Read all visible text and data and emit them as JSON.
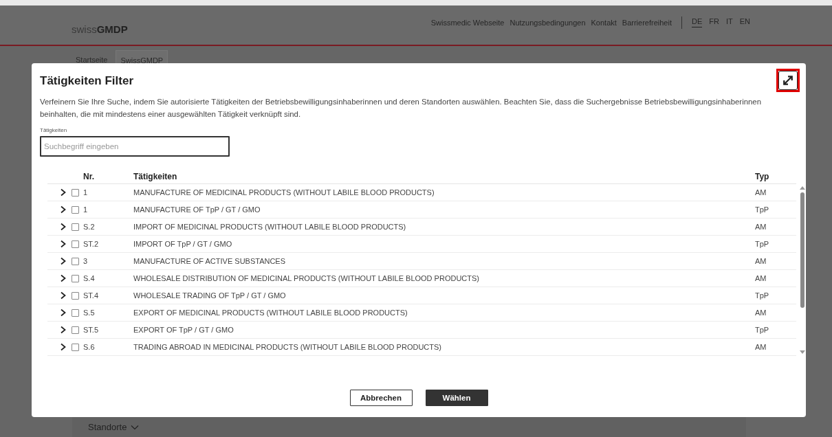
{
  "header": {
    "logo": {
      "prefix": "swiss",
      "name": "GMDP"
    },
    "links": [
      "Swissmedic Webseite",
      "Nutzungsbedingungen",
      "Kontakt",
      "Barrierefreiheit"
    ],
    "languages": [
      {
        "label": "DE",
        "selected": true
      },
      {
        "label": "FR",
        "selected": false
      },
      {
        "label": "IT",
        "selected": false
      },
      {
        "label": "EN",
        "selected": false
      }
    ]
  },
  "tabs": [
    {
      "label": "Startseite",
      "selected": false
    },
    {
      "label": "SwissGMDP",
      "selected": true
    }
  ],
  "dialog": {
    "title": "Tätigkeiten Filter",
    "description": "Verfeinern Sie Ihre Suche, indem Sie autorisierte Tätigkeiten der Betriebsbewilligungsinhaberinnen und deren Standorten auswählen. Beachten Sie, dass die Suchergebnisse Betriebsbewilligungsinhaberinnen beinhalten, die mit mindestens einer ausgewählten Tätigkeit verknüpft sind.",
    "search": {
      "label": "Tätigkeiten",
      "placeholder": "Suchbegriff eingeben"
    },
    "table": {
      "columns": [
        "Nr.",
        "Tätigkeiten",
        "Typ"
      ],
      "rows": [
        {
          "nr": "1",
          "activity": "MANUFACTURE OF MEDICINAL PRODUCTS (WITHOUT LABILE BLOOD PRODUCTS)",
          "typ": "AM",
          "expanded": false,
          "checked": false
        },
        {
          "nr": "1",
          "activity": "MANUFACTURE OF TpP / GT / GMO",
          "typ": "TpP",
          "expanded": false,
          "checked": false
        },
        {
          "nr": "S.2",
          "activity": "IMPORT OF MEDICINAL PRODUCTS (WITHOUT LABILE BLOOD PRODUCTS)",
          "typ": "AM",
          "expanded": false,
          "checked": false
        },
        {
          "nr": "ST.2",
          "activity": "IMPORT OF TpP / GT / GMO",
          "typ": "TpP",
          "expanded": false,
          "checked": false
        },
        {
          "nr": "3",
          "activity": "MANUFACTURE OF ACTIVE SUBSTANCES",
          "typ": "AM",
          "expanded": false,
          "checked": false
        },
        {
          "nr": "S.4",
          "activity": "WHOLESALE DISTRIBUTION OF MEDICINAL PRODUCTS (WITHOUT LABILE BLOOD PRODUCTS)",
          "typ": "AM",
          "expanded": false,
          "checked": false
        },
        {
          "nr": "ST.4",
          "activity": "WHOLESALE TRADING OF TpP / GT / GMO",
          "typ": "TpP",
          "expanded": false,
          "checked": false
        },
        {
          "nr": "S.5",
          "activity": "EXPORT OF MEDICINAL PRODUCTS (WITHOUT LABILE BLOOD PRODUCTS)",
          "typ": "AM",
          "expanded": false,
          "checked": false
        },
        {
          "nr": "ST.5",
          "activity": "EXPORT OF TpP / GT / GMO",
          "typ": "TpP",
          "expanded": false,
          "checked": false
        },
        {
          "nr": "S.6",
          "activity": "TRADING ABROAD IN MEDICINAL PRODUCTS (WITHOUT LABILE BLOOD PRODUCTS)",
          "typ": "AM",
          "expanded": false,
          "checked": false
        }
      ]
    },
    "buttons": [
      {
        "label": "Abbrechen",
        "kind": "secondary"
      },
      {
        "label": "Wählen",
        "kind": "primary"
      }
    ]
  },
  "section": {
    "label": "Standorte",
    "expanded": false
  }
}
